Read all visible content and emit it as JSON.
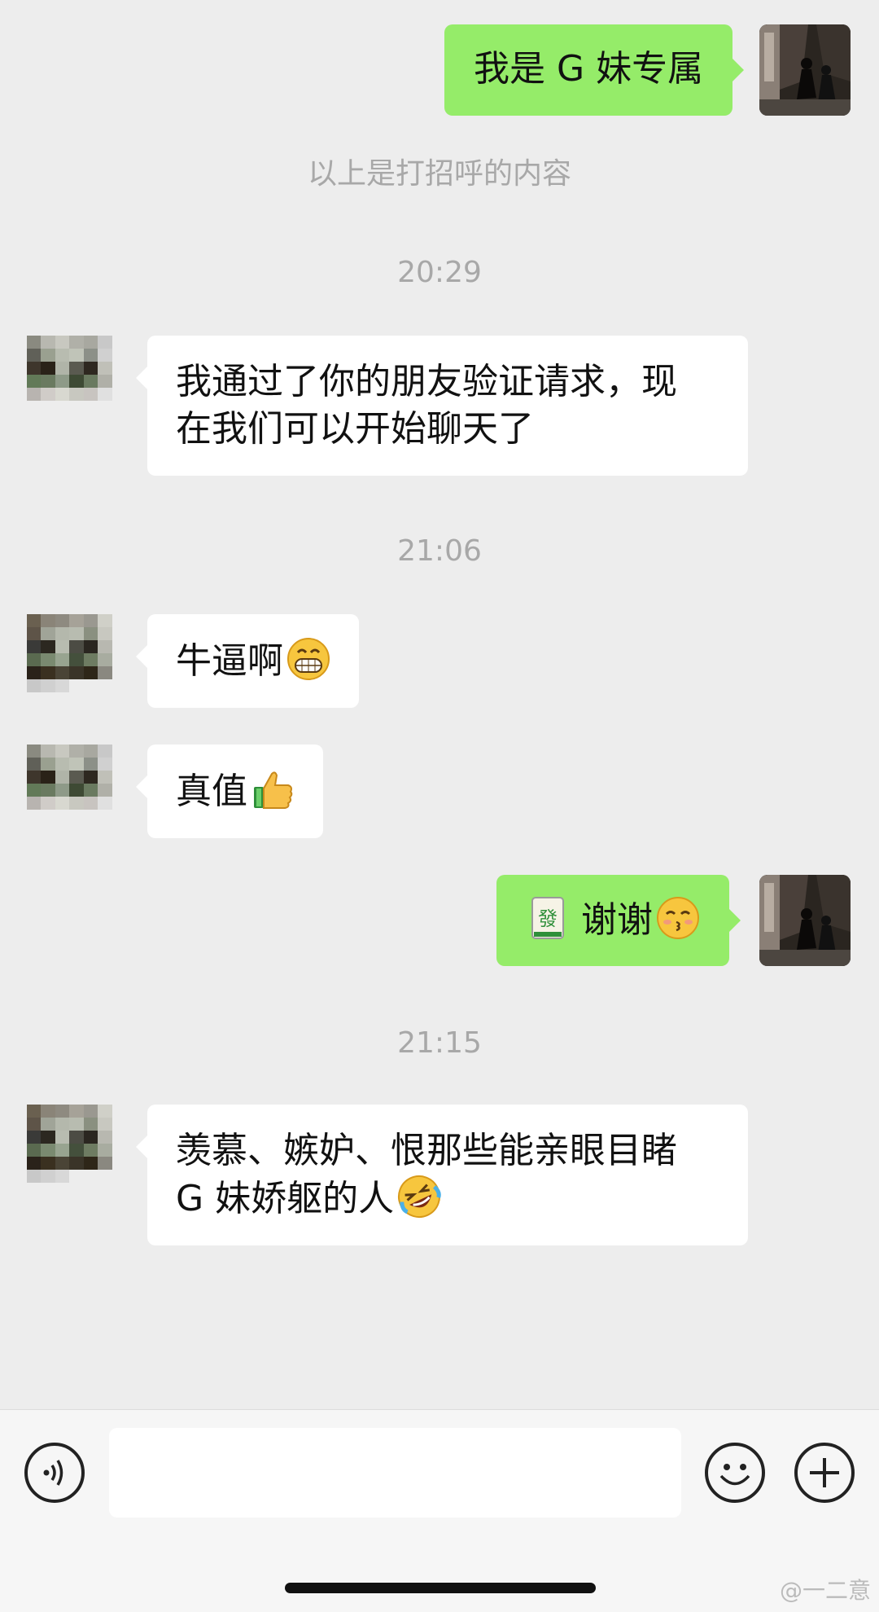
{
  "messages": {
    "m1": "我是 G 妹专属",
    "greeting_note": "以上是打招呼的内容",
    "time1": "20:29",
    "m2_line1": "我通过了你的朋友验证请求，现",
    "m2_line2": "在我们可以开始聊天了",
    "time2": "21:06",
    "m3": "牛逼啊",
    "m4": "真值",
    "m5": "谢谢",
    "time3": "21:15",
    "m6_line1": "羡慕、嫉妒、恨那些能亲眼目睹",
    "m6_line2": "G 妹娇躯的人"
  },
  "emoji": {
    "grin": "grinning-face-icon",
    "thumb": "thumbs-up-icon",
    "mahjong": "mahjong-red-dragon-tile-icon",
    "kiss": "kissing-face-icon",
    "laughcry": "rolling-laughing-icon"
  },
  "composer": {
    "input_value": "",
    "voice_icon": "voice-icon",
    "emoji_icon": "emoji-icon",
    "plus_icon": "plus-icon"
  },
  "watermark": "@一二意",
  "colors": {
    "background": "#ededed",
    "out_bubble": "#95ec69",
    "in_bubble": "#ffffff",
    "system_text": "#a8a8a8"
  }
}
